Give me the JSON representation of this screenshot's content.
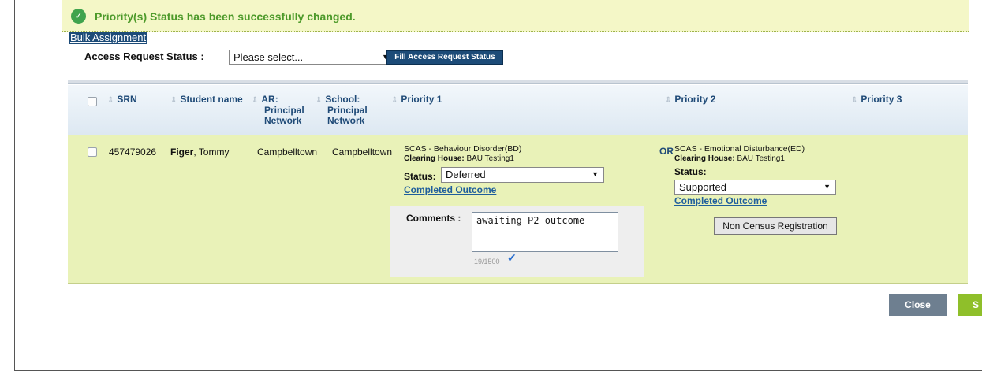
{
  "notification": {
    "message": "Priority(s) Status has been successfully changed.",
    "icon": "check-circle-icon"
  },
  "bulk_assignment": "Bulk Assignment",
  "access_request": {
    "label": "Access Request Status :",
    "selected": "Please select...",
    "fill_button": "Fill Access Request Status"
  },
  "columns": {
    "srn": "SRN",
    "student_name": "Student name",
    "ar_network": [
      "AR:",
      "Principal",
      "Network"
    ],
    "school_network": [
      "School:",
      "Principal",
      "Network"
    ],
    "priority1": "Priority 1",
    "priority2": "Priority 2",
    "priority3": "Priority 3"
  },
  "row": {
    "srn": "457479026",
    "surname": "Figer",
    "given_name": ", Tommy",
    "ar_network": "Campbelltown",
    "school_network": "Campbelltown",
    "priority1": {
      "title": "SCAS - Behaviour Disorder(BD)",
      "clearing_label": "Clearing House:",
      "clearing_value": "BAU Testing1",
      "status_label": "Status:",
      "status_value": "Deferred",
      "outcome_link": "Completed Outcome",
      "comments_label": "Comments :",
      "comment_value": "awaiting P2 outcome",
      "char_count": "19/1500"
    },
    "or_label": "OR",
    "priority2": {
      "title": "SCAS - Emotional Disturbance(ED)",
      "clearing_label": "Clearing House:",
      "clearing_value": "BAU Testing1",
      "status_label": "Status:",
      "status_value": "Supported",
      "outcome_link": "Completed Outcome",
      "ncr_button": "Non Census Registration"
    }
  },
  "footer": {
    "close": "Close",
    "save_partial": "S"
  },
  "colors": {
    "success_bg": "#f4f7c7",
    "success_text": "#4d9a2a",
    "header_text": "#1f4a77",
    "row_bg": "#e9f2b8",
    "accent_navy": "#1c4b78",
    "close_btn": "#6e7f90",
    "save_btn": "#8fbf2a"
  }
}
